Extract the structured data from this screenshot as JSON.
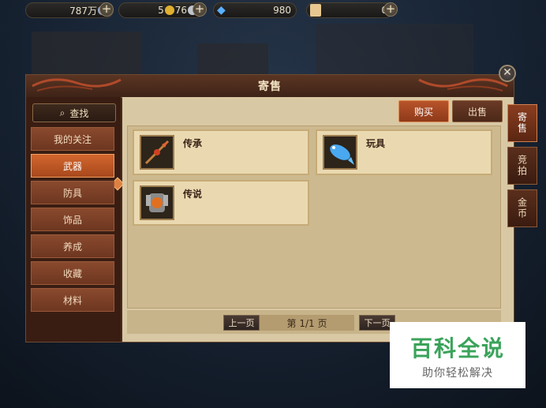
{
  "resources": {
    "currency1": "787万",
    "currency2": "5",
    "currency2b": "76",
    "gems": "980",
    "scroll": "0"
  },
  "panel": {
    "title": "寄售",
    "search_label": "查找",
    "categories": [
      "我的关注",
      "武器",
      "防具",
      "饰品",
      "养成",
      "收藏",
      "材料"
    ],
    "active_category": "武器",
    "buy_label": "购买",
    "sell_label": "出售",
    "items": [
      {
        "name": "传承",
        "icon": "spear-icon"
      },
      {
        "name": "玩具",
        "icon": "blue-fish-icon"
      },
      {
        "name": "传说",
        "icon": "armor-icon"
      }
    ],
    "pager": {
      "prev_label": "上一页",
      "page_label": "第 1/1 页",
      "next_label": "下一页"
    }
  },
  "right_tabs": [
    "寄售",
    "竞拍",
    "金币"
  ],
  "watermark": {
    "title": "百科全说",
    "subtitle": "助你轻松解决"
  },
  "colors": {
    "accent": "#d2662e",
    "panel_bg": "#d9c8a4",
    "watermark_green": "#3aa35a"
  }
}
